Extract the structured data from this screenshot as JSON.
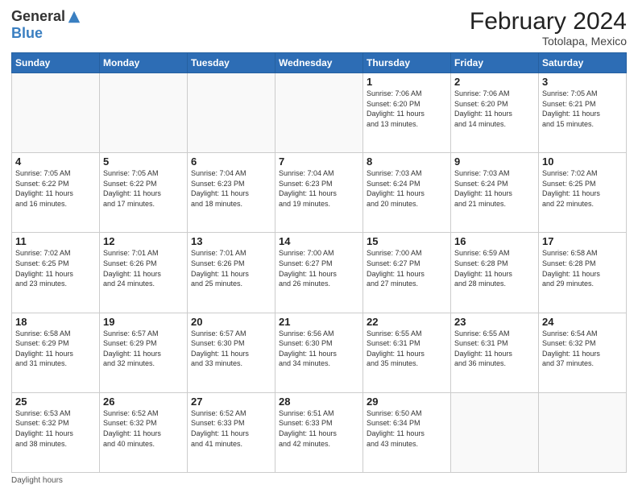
{
  "logo": {
    "general": "General",
    "blue": "Blue"
  },
  "title": "February 2024",
  "subtitle": "Totolapa, Mexico",
  "days_header": [
    "Sunday",
    "Monday",
    "Tuesday",
    "Wednesday",
    "Thursday",
    "Friday",
    "Saturday"
  ],
  "footer": {
    "daylight_label": "Daylight hours"
  },
  "weeks": [
    [
      {
        "num": "",
        "info": ""
      },
      {
        "num": "",
        "info": ""
      },
      {
        "num": "",
        "info": ""
      },
      {
        "num": "",
        "info": ""
      },
      {
        "num": "1",
        "info": "Sunrise: 7:06 AM\nSunset: 6:20 PM\nDaylight: 11 hours\nand 13 minutes."
      },
      {
        "num": "2",
        "info": "Sunrise: 7:06 AM\nSunset: 6:20 PM\nDaylight: 11 hours\nand 14 minutes."
      },
      {
        "num": "3",
        "info": "Sunrise: 7:05 AM\nSunset: 6:21 PM\nDaylight: 11 hours\nand 15 minutes."
      }
    ],
    [
      {
        "num": "4",
        "info": "Sunrise: 7:05 AM\nSunset: 6:22 PM\nDaylight: 11 hours\nand 16 minutes."
      },
      {
        "num": "5",
        "info": "Sunrise: 7:05 AM\nSunset: 6:22 PM\nDaylight: 11 hours\nand 17 minutes."
      },
      {
        "num": "6",
        "info": "Sunrise: 7:04 AM\nSunset: 6:23 PM\nDaylight: 11 hours\nand 18 minutes."
      },
      {
        "num": "7",
        "info": "Sunrise: 7:04 AM\nSunset: 6:23 PM\nDaylight: 11 hours\nand 19 minutes."
      },
      {
        "num": "8",
        "info": "Sunrise: 7:03 AM\nSunset: 6:24 PM\nDaylight: 11 hours\nand 20 minutes."
      },
      {
        "num": "9",
        "info": "Sunrise: 7:03 AM\nSunset: 6:24 PM\nDaylight: 11 hours\nand 21 minutes."
      },
      {
        "num": "10",
        "info": "Sunrise: 7:02 AM\nSunset: 6:25 PM\nDaylight: 11 hours\nand 22 minutes."
      }
    ],
    [
      {
        "num": "11",
        "info": "Sunrise: 7:02 AM\nSunset: 6:25 PM\nDaylight: 11 hours\nand 23 minutes."
      },
      {
        "num": "12",
        "info": "Sunrise: 7:01 AM\nSunset: 6:26 PM\nDaylight: 11 hours\nand 24 minutes."
      },
      {
        "num": "13",
        "info": "Sunrise: 7:01 AM\nSunset: 6:26 PM\nDaylight: 11 hours\nand 25 minutes."
      },
      {
        "num": "14",
        "info": "Sunrise: 7:00 AM\nSunset: 6:27 PM\nDaylight: 11 hours\nand 26 minutes."
      },
      {
        "num": "15",
        "info": "Sunrise: 7:00 AM\nSunset: 6:27 PM\nDaylight: 11 hours\nand 27 minutes."
      },
      {
        "num": "16",
        "info": "Sunrise: 6:59 AM\nSunset: 6:28 PM\nDaylight: 11 hours\nand 28 minutes."
      },
      {
        "num": "17",
        "info": "Sunrise: 6:58 AM\nSunset: 6:28 PM\nDaylight: 11 hours\nand 29 minutes."
      }
    ],
    [
      {
        "num": "18",
        "info": "Sunrise: 6:58 AM\nSunset: 6:29 PM\nDaylight: 11 hours\nand 31 minutes."
      },
      {
        "num": "19",
        "info": "Sunrise: 6:57 AM\nSunset: 6:29 PM\nDaylight: 11 hours\nand 32 minutes."
      },
      {
        "num": "20",
        "info": "Sunrise: 6:57 AM\nSunset: 6:30 PM\nDaylight: 11 hours\nand 33 minutes."
      },
      {
        "num": "21",
        "info": "Sunrise: 6:56 AM\nSunset: 6:30 PM\nDaylight: 11 hours\nand 34 minutes."
      },
      {
        "num": "22",
        "info": "Sunrise: 6:55 AM\nSunset: 6:31 PM\nDaylight: 11 hours\nand 35 minutes."
      },
      {
        "num": "23",
        "info": "Sunrise: 6:55 AM\nSunset: 6:31 PM\nDaylight: 11 hours\nand 36 minutes."
      },
      {
        "num": "24",
        "info": "Sunrise: 6:54 AM\nSunset: 6:32 PM\nDaylight: 11 hours\nand 37 minutes."
      }
    ],
    [
      {
        "num": "25",
        "info": "Sunrise: 6:53 AM\nSunset: 6:32 PM\nDaylight: 11 hours\nand 38 minutes."
      },
      {
        "num": "26",
        "info": "Sunrise: 6:52 AM\nSunset: 6:32 PM\nDaylight: 11 hours\nand 40 minutes."
      },
      {
        "num": "27",
        "info": "Sunrise: 6:52 AM\nSunset: 6:33 PM\nDaylight: 11 hours\nand 41 minutes."
      },
      {
        "num": "28",
        "info": "Sunrise: 6:51 AM\nSunset: 6:33 PM\nDaylight: 11 hours\nand 42 minutes."
      },
      {
        "num": "29",
        "info": "Sunrise: 6:50 AM\nSunset: 6:34 PM\nDaylight: 11 hours\nand 43 minutes."
      },
      {
        "num": "",
        "info": ""
      },
      {
        "num": "",
        "info": ""
      }
    ]
  ]
}
